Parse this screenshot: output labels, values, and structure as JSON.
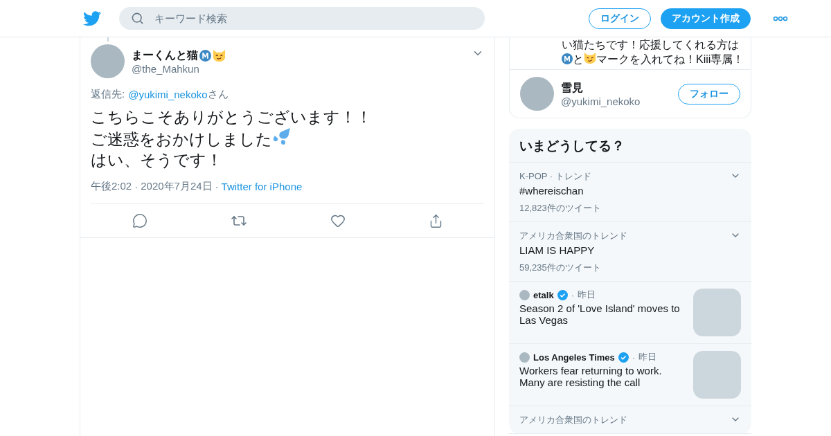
{
  "header": {
    "search": {
      "placeholder": "キーワード検索"
    },
    "login": "ログイン",
    "signup": "アカウント作成"
  },
  "separator": "·",
  "tweet": {
    "name": [
      {
        "kind": "text",
        "text": "まーくんと猫"
      },
      {
        "kind": "m"
      },
      {
        "kind": "cat"
      }
    ],
    "handle": "@the_Mahkun",
    "reply_label": "返信先:",
    "reply_to": "@yukimi_nekoko",
    "reply_suffix": "さん",
    "body": [
      [
        {
          "kind": "text",
          "text": "こちらこそありがとうございます！！"
        }
      ],
      [
        {
          "kind": "text",
          "text": "ご迷惑をおかけしました"
        },
        {
          "kind": "sweat"
        }
      ],
      [
        {
          "kind": "text",
          "text": "はい、そうです！"
        }
      ]
    ],
    "time": "午後2:02",
    "date": "2020年7月24日",
    "source": "Twitter for iPhone"
  },
  "profile_card": {
    "bio": [
      [
        {
          "kind": "text",
          "text": "い猫たちです！応援してくれる方は"
        }
      ],
      [
        {
          "kind": "m"
        },
        {
          "kind": "text",
          "text": "と"
        },
        {
          "kind": "cat"
        },
        {
          "kind": "text",
          "text": "マークを入れてね！Kiii専属！"
        }
      ]
    ],
    "name": "雪見",
    "handle": "@yukimi_nekoko",
    "follow": "フォロー"
  },
  "trends": {
    "title": "いまどうしてる？",
    "items": [
      {
        "kind": "trend",
        "meta": "K-POP · トレンド",
        "title": "#whereischan",
        "count": "12,823件のツイート"
      },
      {
        "kind": "trend",
        "meta": "アメリカ合衆国のトレンド",
        "title": "LIAM IS HAPPY",
        "count": "59,235件のツイート"
      },
      {
        "kind": "news",
        "source": "etalk",
        "verified": true,
        "when": "昨日",
        "title": "Season 2 of 'Love Island' moves to Las Vegas"
      },
      {
        "kind": "news",
        "source": "Los Angeles Times",
        "verified": true,
        "when": "昨日",
        "title": "Workers fear returning to work. Many are resisting the call"
      },
      {
        "kind": "trend",
        "meta": "アメリカ合衆国のトレンド"
      }
    ]
  }
}
